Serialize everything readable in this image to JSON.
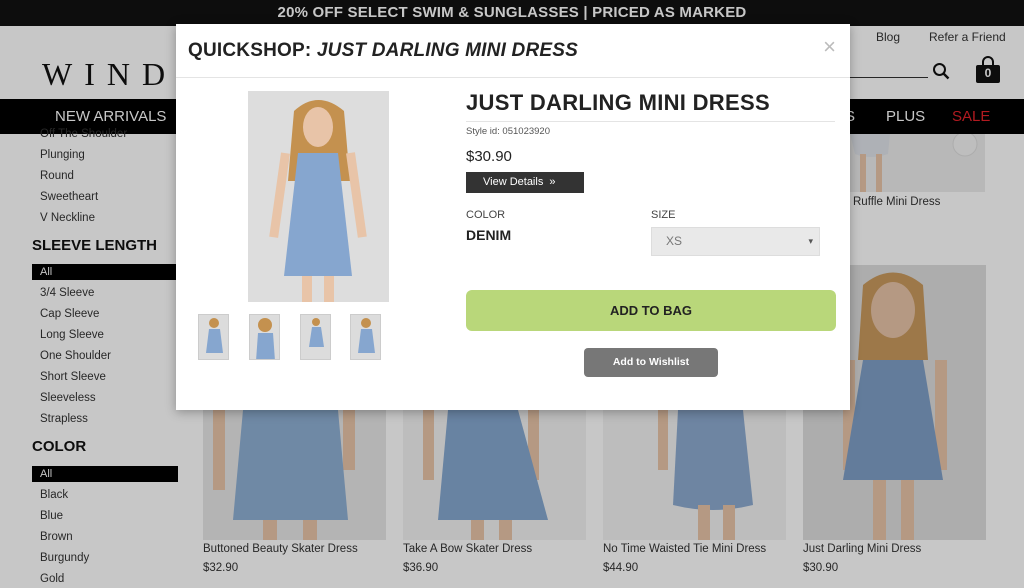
{
  "promo": {
    "text": "20% OFF SELECT SWIM & SUNGLASSES | PRICED AS MARKED"
  },
  "header": {
    "logo": "WIND",
    "links": [
      "Blog",
      "Refer a Friend"
    ],
    "bag_count": "0"
  },
  "nav": {
    "items": [
      "NEW ARRIVALS",
      "S",
      "PLUS",
      "SALE"
    ],
    "sale_color": "#e4222a"
  },
  "sidebar": {
    "neckline_items": [
      "Off The Shoulder",
      "Plunging",
      "Round",
      "Sweetheart",
      "V Neckline"
    ],
    "sleeve_heading": "SLEEVE LENGTH",
    "sleeve_all": "All",
    "sleeve_items": [
      "3/4 Sleeve",
      "Cap Sleeve",
      "Long Sleeve",
      "One Shoulder",
      "Short Sleeve",
      "Sleeveless",
      "Strapless"
    ],
    "color_heading": "COLOR",
    "color_all": "All",
    "color_items": [
      "Black",
      "Blue",
      "Brown",
      "Burgundy",
      "Gold"
    ]
  },
  "grid": {
    "top_right_name": "Ruffle Mini Dress",
    "products": [
      {
        "name": "Buttoned Beauty Skater Dress",
        "price": "$32.90"
      },
      {
        "name": "Take A Bow Skater Dress",
        "price": "$36.90"
      },
      {
        "name": "No Time Waisted Tie Mini Dress",
        "price": "$44.90"
      },
      {
        "name": "Just Darling Mini Dress",
        "price": "$30.90"
      }
    ]
  },
  "modal": {
    "title_prefix": "QUICKSHOP: ",
    "title_product": "JUST DARLING MINI DRESS",
    "close_glyph": "×",
    "product_name": "JUST DARLING MINI DRESS",
    "style_id": "Style id: 051023920",
    "price": "$30.90",
    "view_details": "View Details",
    "view_chevron": "»",
    "color_label": "COLOR",
    "color_value": "DENIM",
    "size_label": "SIZE",
    "size_value": "XS",
    "size_caret": "▾",
    "add_to_bag": "ADD TO BAG",
    "add_to_wishlist": "Add to Wishlist",
    "colors": {
      "add_button": "#b9d77a",
      "wishlist_button": "#777777",
      "view_button": "#333333"
    }
  }
}
